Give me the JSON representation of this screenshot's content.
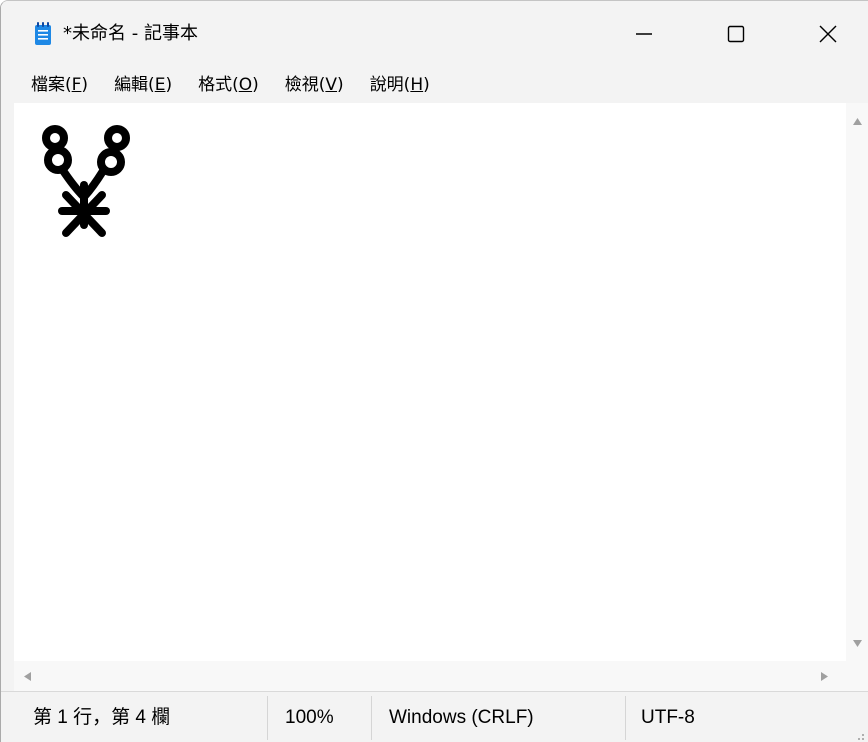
{
  "window": {
    "title": "*未命名 - 記事本",
    "buttons": {
      "minimize": "minimize-icon",
      "maximize": "maximize-icon",
      "close": "close-icon"
    }
  },
  "menu": [
    {
      "text": "檔案(",
      "accel": "F",
      "end": ")"
    },
    {
      "text": "編輯(",
      "accel": "E",
      "end": ")"
    },
    {
      "text": "格式(",
      "accel": "O",
      "end": ")"
    },
    {
      "text": "檢視(",
      "accel": "V",
      "end": ")"
    },
    {
      "text": "說明(",
      "accel": "H",
      "end": ")"
    }
  ],
  "editor": {
    "content_glyph": "pictograph-glyph-icon"
  },
  "status": {
    "position": "第 1 行，第 4 欄",
    "zoom": "100%",
    "line_ending": "Windows (CRLF)",
    "encoding": "UTF-8"
  },
  "colors": {
    "chrome": "#f3f3f3",
    "editor_bg": "#ffffff",
    "icon_blue": "#1e88e5"
  }
}
